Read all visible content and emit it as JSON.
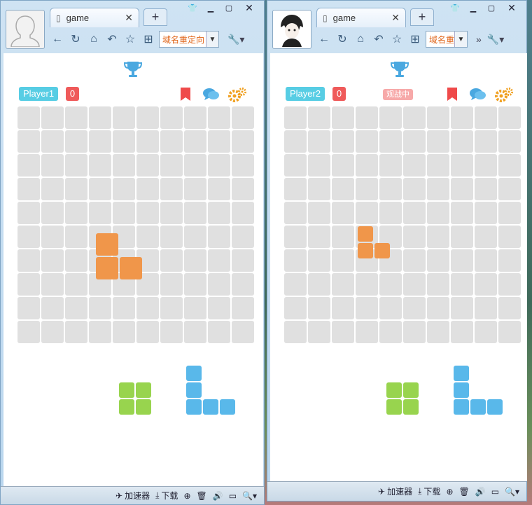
{
  "windows": [
    {
      "tab_title": "game",
      "address_text": "域名重定向",
      "player_name": "Player1",
      "score": "0",
      "spectating_label": "",
      "statusbar": {
        "accelerator": "加速器",
        "download": "下载"
      }
    },
    {
      "tab_title": "game",
      "address_text": "域名重",
      "player_name": "Player2",
      "score": "0",
      "spectating_label": "观战中",
      "statusbar": {
        "accelerator": "加速器",
        "download": "下载"
      }
    }
  ],
  "colors": {
    "piece_orange": "#f0964a",
    "piece_green": "#98d44e",
    "piece_blue": "#59b8ea",
    "player_badge": "#57cde4",
    "score_badge": "#ef5a5a",
    "icon_blue": "#4aa8e0",
    "icon_red": "#ef4a4a",
    "icon_orange": "#f0a020"
  },
  "icons": [
    "trophy-icon",
    "bookmark-icon",
    "chat-icon",
    "settings-gears-icon"
  ]
}
